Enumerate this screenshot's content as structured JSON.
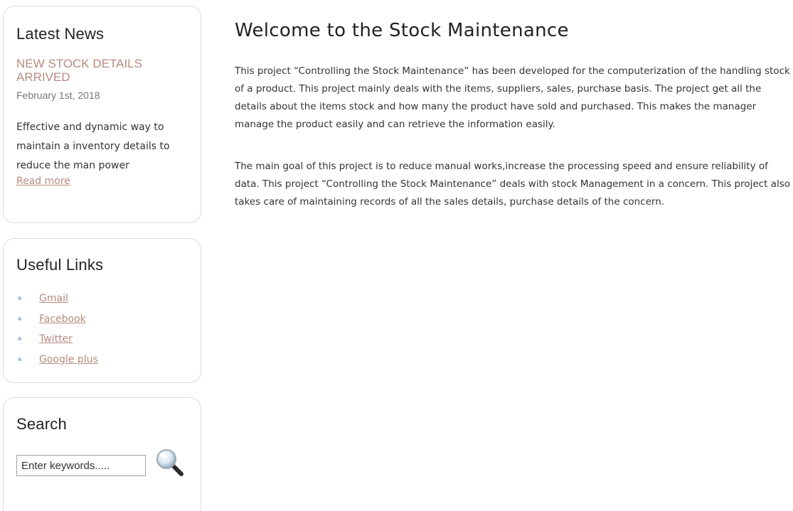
{
  "sidebar": {
    "news": {
      "title": "Latest News",
      "headline": "NEW STOCK DETAILS ARRIVED",
      "date": "February 1st, 2018",
      "body": "Effective and dynamic way to maintain a inventory details to reduce the man power",
      "read_more": "Read more"
    },
    "links": {
      "title": "Useful Links",
      "items": [
        {
          "label": "Gmail"
        },
        {
          "label": "Facebook"
        },
        {
          "label": "Twitter"
        },
        {
          "label": "Google plus"
        }
      ]
    },
    "search": {
      "title": "Search",
      "placeholder": "Enter keywords.....",
      "button_icon": "magnifier-icon"
    }
  },
  "main": {
    "title": "Welcome to the Stock Maintenance",
    "paragraphs": [
      "This project “Controlling the Stock Maintenance” has been developed for the computerization of the handling stock of a product. This project mainly deals with the items, suppliers, sales, purchase basis. The project get all the details about the items stock and how many the product have sold and purchased. This makes the manager manage the product easily and can retrieve the information easily.",
      "The main goal of this project is to reduce manual works,increase the processing speed and ensure reliability of data. This project “Controlling the Stock Maintenance” deals with stock Management in a concern. This project also takes care of maintaining records of all the sales details, purchase details of the concern."
    ]
  },
  "colors": {
    "link": "#b88a80",
    "heading": "#222222",
    "text": "#333333",
    "box_border": "#dcdcdc"
  }
}
